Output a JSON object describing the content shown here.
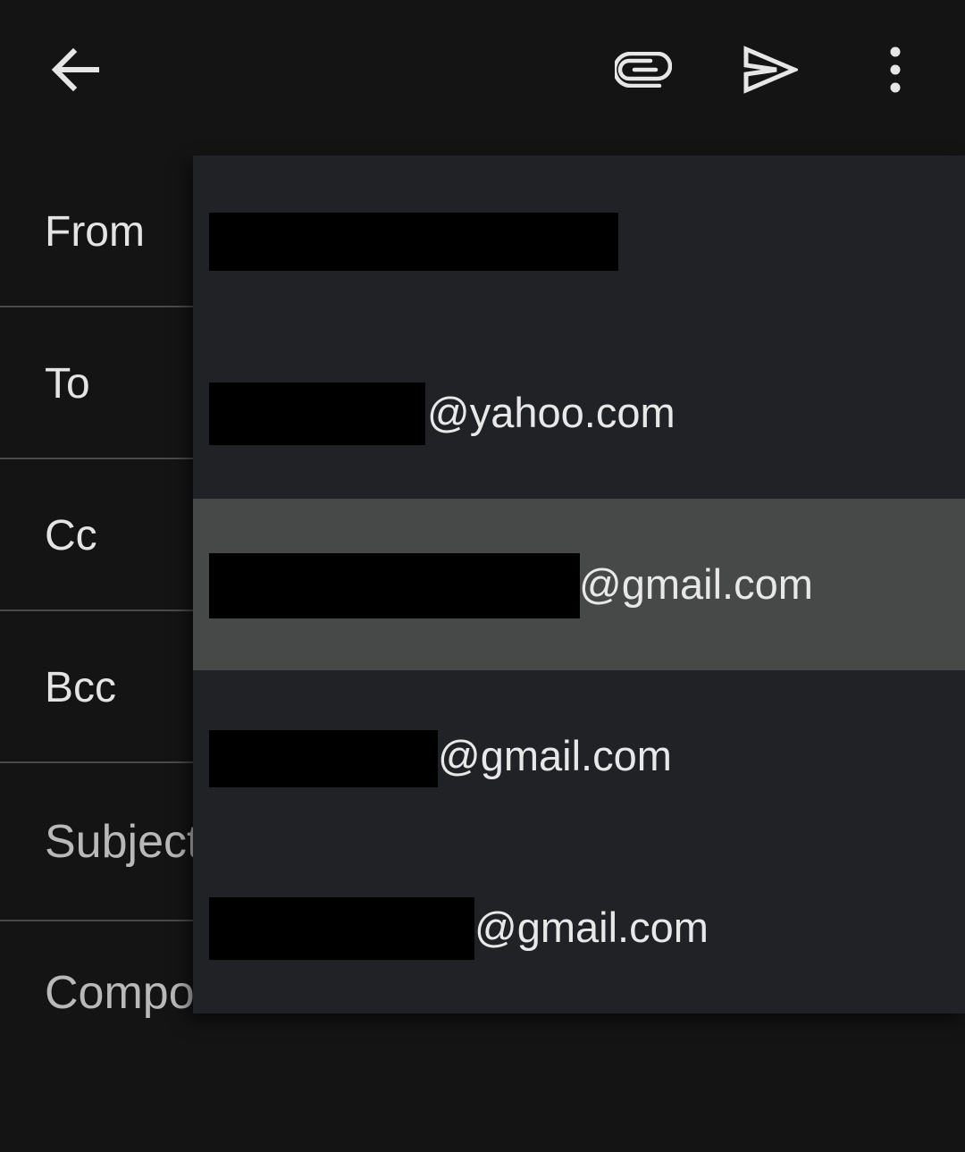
{
  "toolbar": {
    "back": {
      "icon": "arrow-left-icon"
    },
    "attach": {
      "icon": "paperclip-icon"
    },
    "send": {
      "icon": "send-icon"
    },
    "more": {
      "icon": "more-vertical-icon"
    },
    "icon_color": "#e6e6e6"
  },
  "form": {
    "from_label": "From",
    "to_label": "To",
    "cc_label": "Cc",
    "bcc_label": "Bcc",
    "subject_label": "Subject",
    "compose_label": "Compose email"
  },
  "from_dropdown": {
    "selected_index": 2,
    "accounts": [
      {
        "local_part": "[redacted]",
        "domain": ""
      },
      {
        "local_part": "[redacted]",
        "domain": "@yahoo.com"
      },
      {
        "local_part": "[redacted]",
        "domain": "@gmail.com"
      },
      {
        "local_part": "[redacted]",
        "domain": "@gmail.com"
      },
      {
        "local_part": "[redacted]",
        "domain": "@gmail.com"
      }
    ]
  },
  "colors": {
    "background": "#141414",
    "dropdown": "#212226",
    "selected": "#474848",
    "divider": "#4a4a4a"
  }
}
